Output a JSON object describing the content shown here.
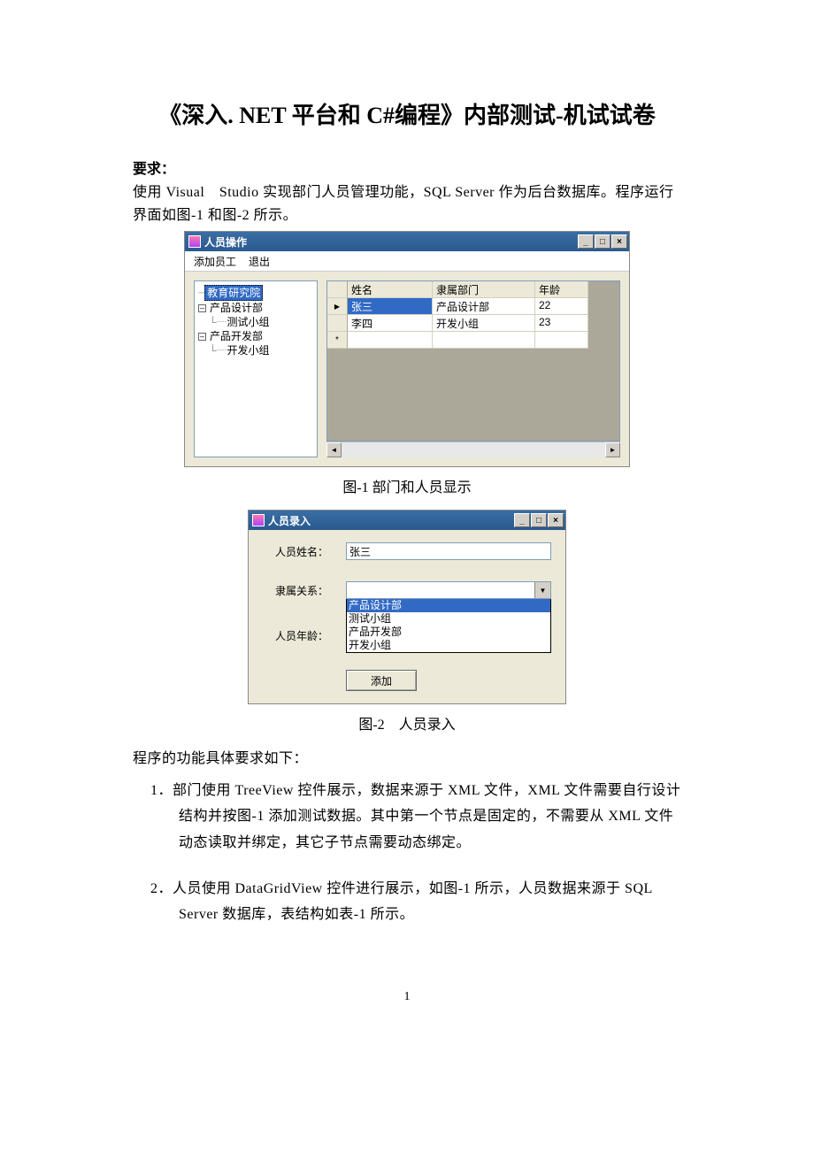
{
  "doc": {
    "title": "《深入. NET 平台和 C#编程》内部测试-机试试卷",
    "req_label": "要求：",
    "intro": "使用 Visual　Studio 实现部门人员管理功能，SQL Server 作为后台数据库。程序运行界面如图-1 和图-2 所示。",
    "caption1": "图-1 部门和人员显示",
    "caption2": "图-2　人员录入",
    "req_intro": "程序的功能具体要求如下：",
    "req1": "1．部门使用 TreeView 控件展示，数据来源于 XML 文件，XML 文件需要自行设计结构并按图-1 添加测试数据。其中第一个节点是固定的，不需要从 XML 文件动态读取并绑定，其它子节点需要动态绑定。",
    "req2": "2．人员使用 DataGridView 控件进行展示，如图-1 所示，人员数据来源于 SQL Server 数据库，表结构如表-1 所示。",
    "pagenum": "1"
  },
  "win1": {
    "title": "人员操作",
    "menu_add": "添加员工",
    "menu_quit": "退出",
    "tree": {
      "root": "教育研究院",
      "d1": "产品设计部",
      "d1c": "测试小组",
      "d2": "产品开发部",
      "d2c": "开发小组"
    },
    "grid": {
      "h_name": "姓名",
      "h_dept": "隶属部门",
      "h_age": "年龄",
      "r1_name": "张三",
      "r1_dept": "产品设计部",
      "r1_age": "22",
      "r2_name": "李四",
      "r2_dept": "开发小组",
      "r2_age": "23"
    }
  },
  "win2": {
    "title": "人员录入",
    "lbl_name": "人员姓名：",
    "lbl_rel": "隶属关系：",
    "lbl_age": "人员年龄：",
    "val_name": "张三",
    "combo_text": "",
    "opts": {
      "o1": "产品设计部",
      "o2": "测试小组",
      "o3": "产品开发部",
      "o4": "开发小组"
    },
    "btn_add": "添加"
  }
}
